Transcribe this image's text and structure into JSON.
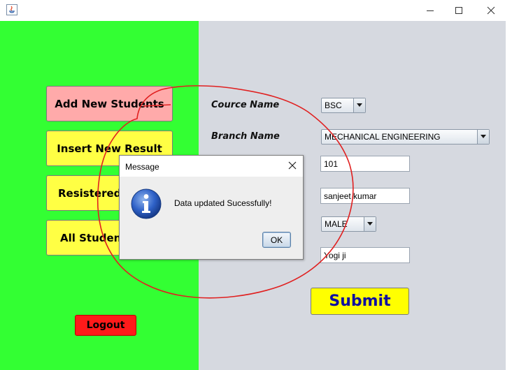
{
  "window": {
    "minimize_glyph": "—",
    "maximize_glyph": "☐",
    "close_glyph": "✕"
  },
  "sidebar": {
    "items": [
      {
        "label": "Add New Students",
        "color": "#ffaaaa"
      },
      {
        "label": "Insert New Result",
        "color": "#ffff44"
      },
      {
        "label": "Resistered S",
        "color": "#ffff44"
      },
      {
        "label": "All Student",
        "color": "#ffff44"
      }
    ],
    "logout_label": "Logout"
  },
  "form": {
    "cource_label": "Cource Name",
    "cource_value": "BSC",
    "branch_label": "Branch Name",
    "branch_value": "MECHANICAL ENGINEERING",
    "roll_value": "101",
    "name_value": "sanjeet kumar",
    "gender_value": "MALE",
    "father_value": "Yogi ji",
    "submit_label": "Submit"
  },
  "dialog": {
    "title": "Message",
    "message": "Data updated Sucessfully!",
    "ok_label": "OK",
    "icon": "info-icon"
  },
  "colors": {
    "left_panel": "#33ff33",
    "right_panel": "#d6d9e0",
    "logout": "#ff1a1a",
    "submit_bg": "#ffff00",
    "submit_text": "#1010a0",
    "annotation": "#e02020"
  }
}
